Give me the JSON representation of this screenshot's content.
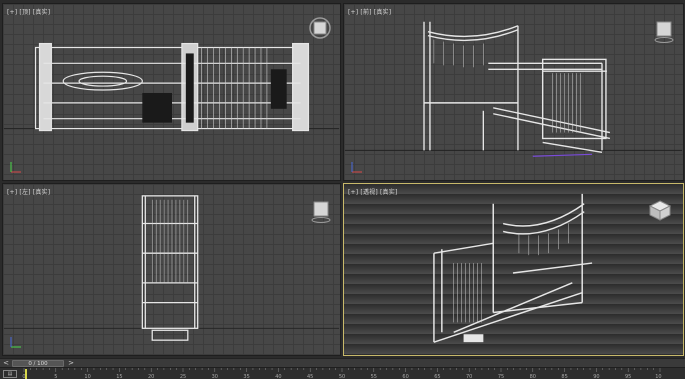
{
  "viewports": {
    "top": {
      "label": "[+] [顶] [真实]"
    },
    "front": {
      "label": "[+] [前] [真实]"
    },
    "left": {
      "label": "[+] [左] [真实]"
    },
    "perspective": {
      "label": "[+] [透视] [真实]"
    }
  },
  "timeslider": {
    "prev_label": "<",
    "next_label": ">",
    "frame_display": "0 / 100"
  },
  "trackbar": {
    "ticks": [
      "0",
      "5",
      "10",
      "15",
      "20",
      "25",
      "30",
      "35",
      "40",
      "45",
      "50",
      "55",
      "60",
      "65",
      "70",
      "75",
      "80",
      "85",
      "90",
      "95",
      "100"
    ],
    "current_frame": 0,
    "total_frames": 100
  },
  "colors": {
    "viewport_bg": "#474747",
    "grid": "#3c3c3c",
    "active_border": "#c8b96a",
    "geometry": "#e6e6e6",
    "marker": "#d8d84a"
  }
}
